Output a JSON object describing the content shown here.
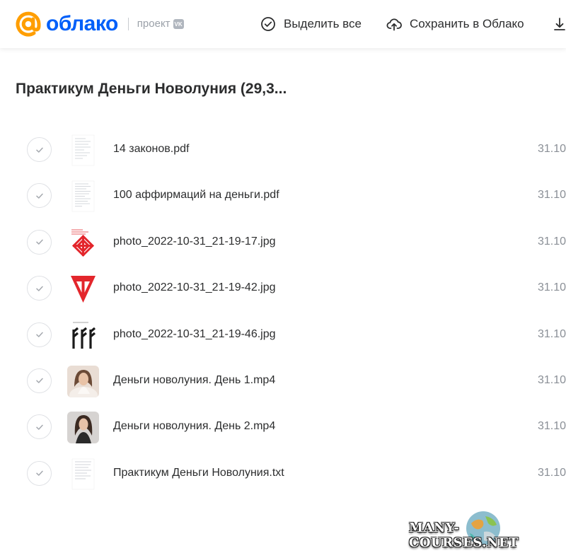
{
  "header": {
    "logo_word": "облако",
    "logo_project": "проект",
    "logo_vk": "VK",
    "select_all_label": "Выделить все",
    "save_label": "Сохранить в Облако"
  },
  "folder": {
    "title": "Практикум Деньги Новолуния (29,3..."
  },
  "files": [
    {
      "name": "14 законов.pdf",
      "date": "31.10.",
      "type": "pdf"
    },
    {
      "name": "100 аффирмаций на деньги.pdf",
      "date": "31.10.",
      "type": "pdf"
    },
    {
      "name": "photo_2022-10-31_21-19-17.jpg",
      "date": "31.10.",
      "type": "image"
    },
    {
      "name": "photo_2022-10-31_21-19-42.jpg",
      "date": "31.10.",
      "type": "image"
    },
    {
      "name": "photo_2022-10-31_21-19-46.jpg",
      "date": "31.10.",
      "type": "image"
    },
    {
      "name": "Деньги новолуния. День 1.mp4",
      "date": "31.10.",
      "type": "video"
    },
    {
      "name": "Деньги новолуния. День 2.mp4",
      "date": "31.10.",
      "type": "video"
    },
    {
      "name": "Практикум Деньги Новолуния.txt",
      "date": "31.10.",
      "type": "text"
    }
  ],
  "watermark": {
    "text": "MANY-COURSES.NET"
  },
  "colors": {
    "brand_orange": "#ff9e00",
    "brand_blue": "#005ff9",
    "symbol_red": "#e3262c"
  },
  "icons": [
    "at-logo-icon",
    "check-circle-icon",
    "cloud-upload-icon",
    "download-icon",
    "check-icon"
  ]
}
